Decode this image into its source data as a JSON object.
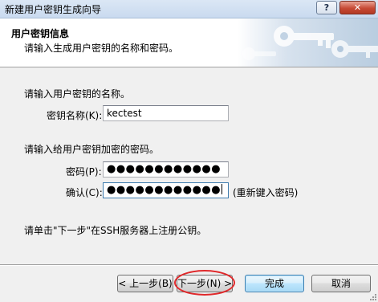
{
  "window": {
    "title": "新建用户密钥生成向导",
    "help_label": "?",
    "close_label": "✕"
  },
  "header": {
    "title": "用户密钥信息",
    "subtitle": "请输入生成用户密钥的名称和密码。",
    "art_icon": "keys-icon"
  },
  "key_name": {
    "prompt": "请输入用户密钥的名称。",
    "label": "密钥名称(K):",
    "value": "kectest"
  },
  "password": {
    "prompt": "请输入给用户密钥加密的密码。",
    "password_label": "密码(P):",
    "password_value": "●●●●●●●●●●●●",
    "confirm_label": "确认(C):",
    "confirm_value": "●●●●●●●●●●●●",
    "reenter_hint": "(重新键入密码)"
  },
  "instruction": "请单击\"下一步\"在SSH服务器上注册公钥。",
  "buttons": {
    "back": "< 上一步(B)",
    "next": "下一步(N) >",
    "finish": "完成",
    "cancel": "取消"
  },
  "colors": {
    "annotation_circle": "#e0292b",
    "dialog_bg": "#f0f0f0",
    "title_bar": "#c9daef"
  }
}
